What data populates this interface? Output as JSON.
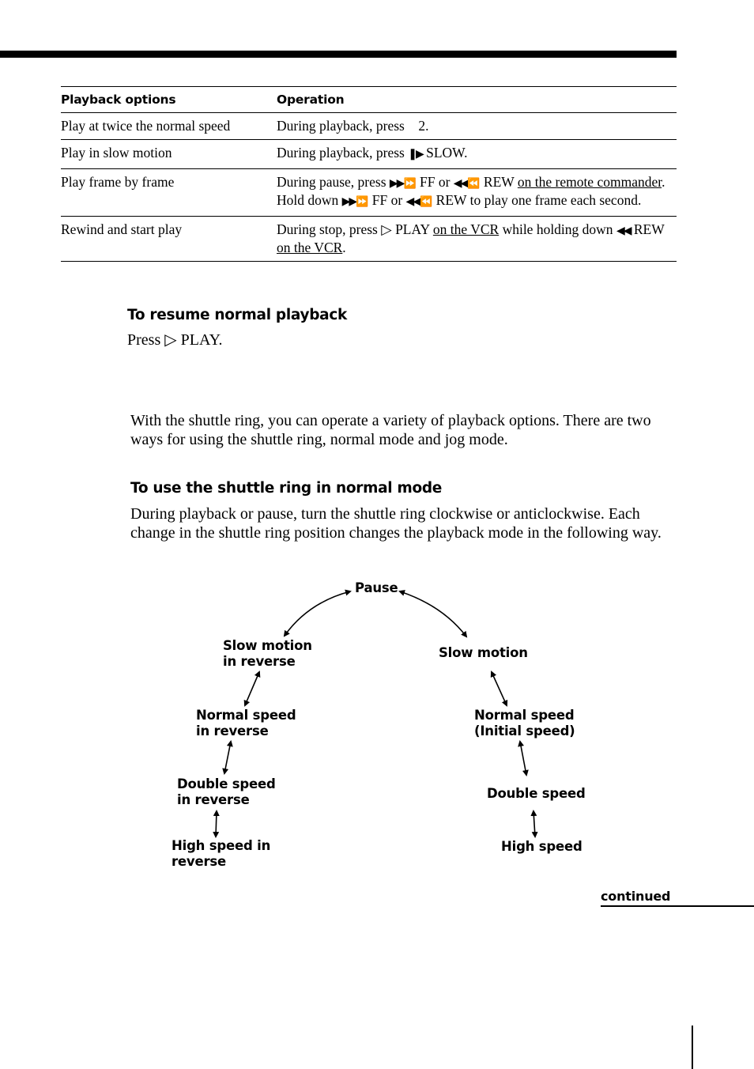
{
  "table": {
    "headers": [
      "Playback options",
      "Operation"
    ],
    "rows": [
      {
        "option": "Play at twice the normal speed",
        "operation": {
          "pre": "During playback, press",
          "key": "2",
          "post": "."
        }
      },
      {
        "option": "Play in slow motion",
        "operation": {
          "pre": "During playback, press",
          "icon": "slow-icon",
          "key": "SLOW",
          "post": "."
        }
      },
      {
        "option": "Play frame by frame",
        "operation": {
          "p1": "During pause, press",
          "ff_label": "FF",
          "or": "or",
          "rew_label": "REW",
          "link1": "on the remote commander",
          "p2": ".  Hold down",
          "p3": "to play one frame each second."
        }
      },
      {
        "option": "Rewind and start play",
        "operation": {
          "p1": "During stop, press",
          "play_label": "PLAY",
          "link1": "on the VCR",
          "p2": "while holding down",
          "rew_label": "REW",
          "link2": "on the VCR",
          "post": "."
        }
      }
    ]
  },
  "resume": {
    "heading": "To resume normal playback",
    "press": "Press",
    "play_label": "PLAY."
  },
  "shuttle": {
    "intro": "With the shuttle ring, you can operate a variety of playback options.  There are two ways for using the shuttle ring, normal mode and jog mode.",
    "normal_heading": "To use the shuttle ring in normal mode",
    "normal_text": "During playback or pause, turn the shuttle ring clockwise or anticlockwise. Each change in the shuttle ring position changes the playback mode in the following way."
  },
  "diagram": {
    "center": "Pause",
    "reverse": [
      "Slow motion\nin reverse",
      "Normal speed\nin reverse",
      "Double speed\nin reverse",
      "High speed in\nreverse"
    ],
    "forward": [
      "Slow motion",
      "Normal speed\n(Initial speed)",
      "Double speed",
      "High speed"
    ]
  },
  "footer": {
    "continued": "continued"
  },
  "icons": {
    "ff": "▶▶",
    "rew": "◀◀",
    "ff_circle": "⏩",
    "rew_circle": "⏪",
    "slow": "❚▶",
    "play": "▷"
  }
}
